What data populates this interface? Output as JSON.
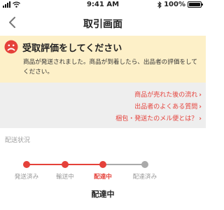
{
  "status_bar": {
    "time": "9:41 AM",
    "battery": "100%",
    "battery_level": 1.0,
    "icons": [
      "signal-icon",
      "wifi-icon",
      "bluetooth-icon",
      "battery-icon"
    ]
  },
  "nav": {
    "title": "取引画面",
    "back_icon": "chevron-left-icon"
  },
  "notice": {
    "icon": "sad-face-icon",
    "title": "受取評価をしてください",
    "body": "商品が発送されました。商品が到着したら、出品者の評価をしてください。"
  },
  "help_links": [
    {
      "label": "商品が売れた後の流れ"
    },
    {
      "label": "出品者のよくある質問"
    },
    {
      "label": "梱包・発送たのメル便とは？"
    }
  ],
  "shipping": {
    "section_label": "配送状況",
    "steps": [
      {
        "label": "発送済み",
        "state": "done"
      },
      {
        "label": "輸送中",
        "state": "done"
      },
      {
        "label": "配達中",
        "state": "current"
      },
      {
        "label": "配達済み",
        "state": "pending"
      }
    ],
    "current_status": "配達中"
  },
  "colors": {
    "accent": "#e5413a",
    "notice_bg": "#fdf0c8",
    "inactive": "#aaaaaa",
    "links_bg": "#eeeeee"
  }
}
